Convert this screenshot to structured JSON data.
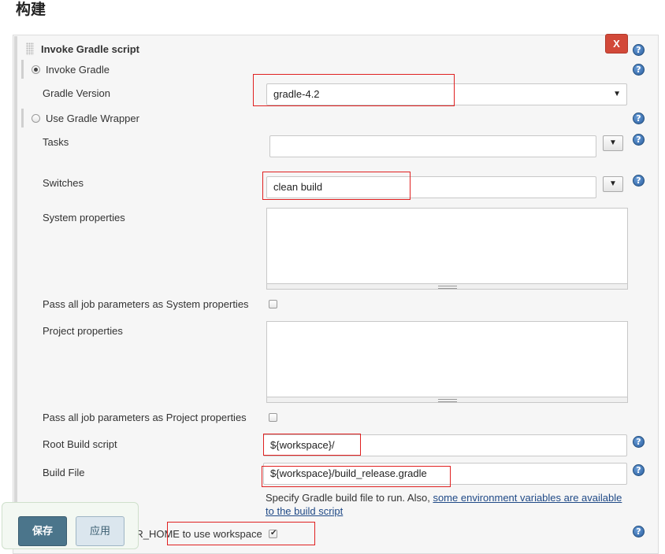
{
  "section": {
    "title": "构建"
  },
  "step": {
    "title": "Invoke Gradle script",
    "delete_label": "X"
  },
  "form": {
    "invoke_gradle_label": "Invoke Gradle",
    "invoke_gradle_selected": true,
    "gradle_version_label": "Gradle Version",
    "gradle_version_value": "gradle-4.2",
    "use_wrapper_label": "Use Gradle Wrapper",
    "use_wrapper_selected": false,
    "tasks_label": "Tasks",
    "tasks_value": "",
    "switches_label": "Switches",
    "switches_value": "clean build",
    "system_properties_label": "System properties",
    "pass_system_label": "Pass all job parameters as System properties",
    "pass_system_checked": false,
    "project_properties_label": "Project properties",
    "pass_project_label": "Pass all job parameters as Project properties",
    "pass_project_checked": false,
    "root_build_script_label": "Root Build script",
    "root_build_script_value": "${workspace}/",
    "build_file_label": "Build File",
    "build_file_value": "${workspace}/build_release.gradle",
    "build_file_hint": "Specify Gradle build file to run. Also, ",
    "build_file_hint_link": "some environment variables are available",
    "build_file_hint_link2": "to the build script",
    "gradle_user_home_label_partial": "SER_HOME to use workspace",
    "gradle_user_home_checked": true
  },
  "icons": {
    "help": "help-icon",
    "dropdown": "dropdown-arrow-icon"
  },
  "help_glyph": "?",
  "arrow_glyph": "▼",
  "buttons": {
    "save_label": "保存",
    "apply_label": "应用"
  },
  "colors": {
    "delete": "#d24939",
    "save": "#4b758b",
    "highlight": "#e02020",
    "help": "#2a5d9e"
  }
}
